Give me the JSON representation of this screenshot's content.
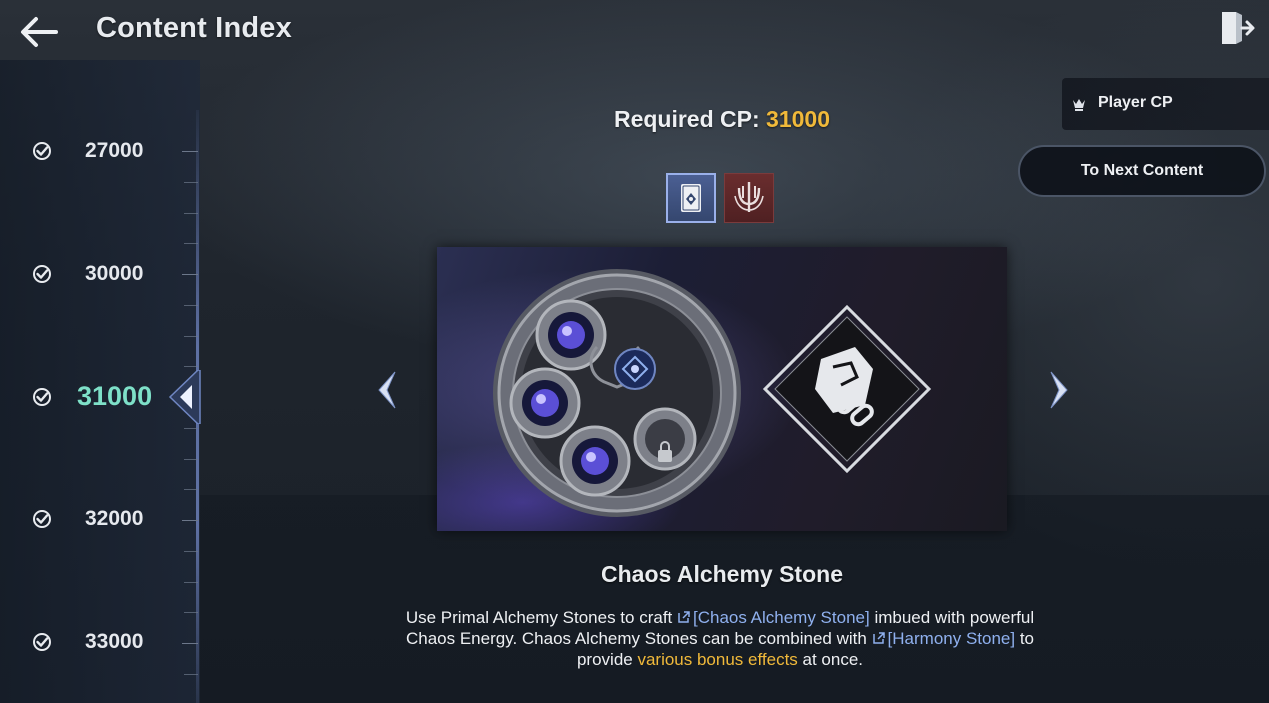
{
  "header": {
    "title": "Content Index"
  },
  "sidebar": {
    "levels": [
      {
        "value": "27000",
        "completed": true,
        "active": false
      },
      {
        "value": "30000",
        "completed": true,
        "active": false
      },
      {
        "value": "31000",
        "completed": true,
        "active": true
      },
      {
        "value": "32000",
        "completed": true,
        "active": false
      },
      {
        "value": "33000",
        "completed": true,
        "active": false
      }
    ]
  },
  "main": {
    "required_label": "Required CP:",
    "required_value": "31000",
    "tabs": [
      {
        "icon": "card-icon",
        "selected": true
      },
      {
        "icon": "trident-icon",
        "selected": false
      }
    ],
    "banner_icons": [
      "alchemy-stone-disc-icon",
      "chain-stone-diamond-icon"
    ],
    "stone_name": "Chaos Alchemy Stone",
    "description": {
      "p1": "Use Primal Alchemy Stones to craft ",
      "link1": "[Chaos Alchemy Stone]",
      "p2": " imbued with powerful Chaos Energy. Chaos Alchemy Stones can be combined with ",
      "link2": "[Harmony Stone]",
      "p3": " to provide ",
      "highlight": "various bonus effects",
      "p4": " at once."
    }
  },
  "right": {
    "player_cp_label": "Player CP",
    "next_button_label": "To Next Content"
  },
  "colors": {
    "accent_gold": "#f0b93a",
    "active_level": "#7ee0c8",
    "link_blue": "#8fb0ee"
  }
}
